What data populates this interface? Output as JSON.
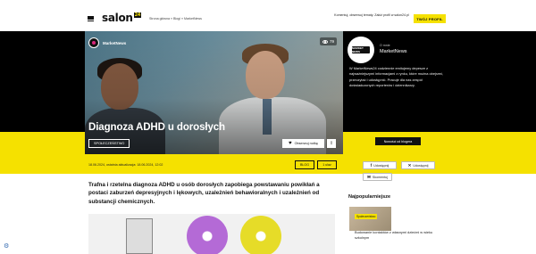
{
  "header": {
    "logo_text": "salon",
    "logo_badge": "24",
    "breadcrumb": "Strona główna  »  Blogi  »  MarketNews",
    "promo_text": "Komentuj, obserwuj tematy. Załóż profil w salon24.pl",
    "promo_button": "TWÓJ PROFIL"
  },
  "hero": {
    "author_name": "MarketNews",
    "views": "79",
    "title": "Diagnoza ADHD u dorosłych",
    "tag": "SPOŁECZEŃSTWO",
    "save_label": "Obserwuj notkę",
    "share_label": "⇪"
  },
  "meta": {
    "dates": "18.06.2024, ostatnia aktualizacja: 18.06.2024, 12:02",
    "blog_label": "BLOG",
    "comments_label": "1 ulaz"
  },
  "author_card": {
    "avatar_text": "MARKET NEWS",
    "label": "O mnie",
    "name": "MarketNews",
    "description": "W MarketNews24 codziennie emitujemy depesze z najważniejszymi informacjami z rynku, które można obejrzeć, przeczytać i udostępnić. Pracuje dla nas zespół doświadczonych reporterów i dziennikarzy.",
    "follow_button": "Nowości od blogera"
  },
  "social": {
    "facebook_label": "Udostępnij",
    "x_label": "Udostępnij",
    "mail_label": "Skomentuj"
  },
  "article": {
    "lead": "Trafna i rzetelna diagnoza ADHD u osób dorosłych zapobiega powstawaniu powikłań a postaci zaburzeń depresyjnych i lękowych, uzależnień behawioralnych i uzależnień od substancji chemicznych."
  },
  "sidebar": {
    "popular_title": "Najpopularniejsze",
    "popular_badge": "Społeczeństwo",
    "popular_item": "Budowanie kontaktów z własnymi dziećmi w wieku szkolnym"
  },
  "colors": {
    "accent_yellow": "#f5e100",
    "band_black": "#000000"
  },
  "icons": {
    "settings": "gear-icon",
    "views": "eye-icon",
    "save": "heart-icon",
    "menu": "hamburger-icon"
  }
}
